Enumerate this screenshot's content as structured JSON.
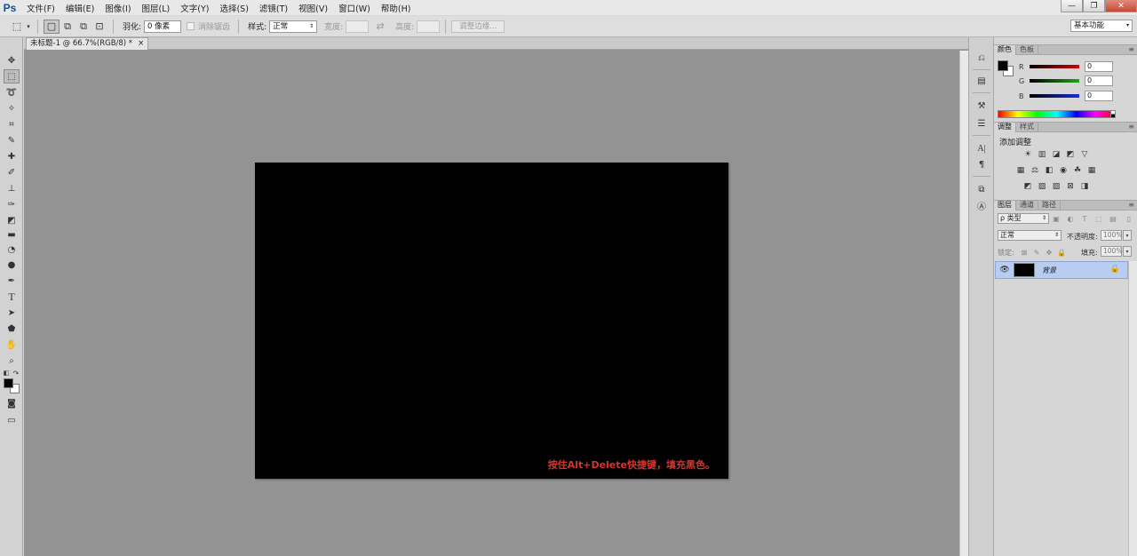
{
  "app": {
    "logo": "Ps"
  },
  "menu": [
    "文件(F)",
    "编辑(E)",
    "图像(I)",
    "图层(L)",
    "文字(Y)",
    "选择(S)",
    "滤镜(T)",
    "视图(V)",
    "窗口(W)",
    "帮助(H)"
  ],
  "window_controls": {
    "minimize": "—",
    "restore": "❐",
    "close": "✕"
  },
  "options": {
    "feather_label": "羽化:",
    "feather_value": "0 像素",
    "antialias_label": "消除锯齿",
    "style_label": "样式:",
    "style_value": "正常",
    "width_label": "宽度:",
    "height_label": "高度:",
    "refine_edge_label": "调整边缘...",
    "workspace": "基本功能"
  },
  "document": {
    "tab_title": "未标题-1 @ 66.7%(RGB/8) *",
    "tab_close": "×",
    "annotation": "按住Alt+Delete快捷键，填充黑色。",
    "canvas_color": "#000000"
  },
  "color_panel": {
    "tabs": [
      "颜色",
      "色板"
    ],
    "channels": [
      {
        "label": "R",
        "value": "0",
        "color": "#d40000"
      },
      {
        "label": "G",
        "value": "0",
        "color": "#1fa31f"
      },
      {
        "label": "B",
        "value": "0",
        "color": "#1a2fd6"
      }
    ]
  },
  "adjustments_panel": {
    "tabs": [
      "调整",
      "样式"
    ],
    "title": "添加调整"
  },
  "layers_panel": {
    "tabs": [
      "图层",
      "通道",
      "路径"
    ],
    "filter_kind": "ρ 类型",
    "blend_mode": "正常",
    "opacity_label": "不透明度:",
    "opacity_value": "100%",
    "lock_label": "锁定:",
    "fill_label": "填充:",
    "fill_value": "100%",
    "layers": [
      {
        "name": "背景",
        "thumb_color": "#000000",
        "visible": true,
        "locked": true
      }
    ]
  },
  "colors": {
    "annotation_red": "#d6342b",
    "selected_layer": "#b9cdf0",
    "ps_blue": "#0f4f9e"
  }
}
